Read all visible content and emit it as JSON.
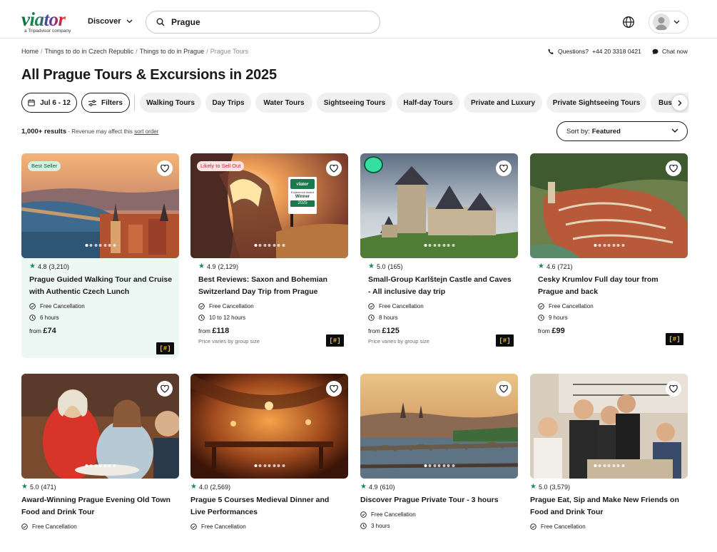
{
  "header": {
    "logo_text": "viator",
    "logo_sub": "a Tripadvisor company",
    "discover_label": "Discover",
    "search_value": "Prague"
  },
  "breadcrumb": [
    "Home",
    "Things to do in Czech Republic",
    "Things to do in Prague",
    "Prague Tours"
  ],
  "contact": {
    "questions_label": "Questions?",
    "phone": "+44 20 3318 0421",
    "chat_label": "Chat now"
  },
  "page_title": "All Prague Tours & Excursions in 2025",
  "filters": {
    "date_label": "Jul 6 - 12",
    "filters_label": "Filters",
    "categories": [
      "Walking Tours",
      "Day Trips",
      "Water Tours",
      "Sightseeing Tours",
      "Half-day Tours",
      "Private and Luxury",
      "Private Sightseeing Tours",
      "Bus"
    ]
  },
  "results": {
    "count": "1,000+ results",
    "note": "- Revenue may affect this",
    "sort_link": "sort order",
    "sort_prefix": "Sort by:",
    "sort_value": "Featured"
  },
  "products": [
    {
      "tag": "Best Seller",
      "rating": "4.8",
      "reviews": "(3,210)",
      "title": "Prague Guided Walking Tour and Cruise with Authentic Czech Lunch",
      "cancellation": "Free Cancellation",
      "duration": "6 hours",
      "price_prefix": "from",
      "price": "£74",
      "price_note": "",
      "badge": "[#]"
    },
    {
      "tag": "Likely to Sell Out",
      "rating": "4.9",
      "reviews": "(2,129)",
      "title": "Best Reviews: Saxon and Bohemian Switzerland Day Trip from Prague",
      "cancellation": "Free Cancellation",
      "duration": "10 to 12 hours",
      "price_prefix": "from",
      "price": "£118",
      "price_note": "Price varies by group size",
      "badge": "[#]",
      "award": {
        "brand": "viator",
        "line1": "Experience Award",
        "line2": "Winner",
        "year": "2025"
      }
    },
    {
      "tag": "",
      "rating": "5.0",
      "reviews": "(165)",
      "title": "Small-Group Karlštejn Castle and Caves - All inclusive day trip",
      "cancellation": "Free Cancellation",
      "duration": "8 hours",
      "price_prefix": "from",
      "price": "£125",
      "price_note": "Price varies by group size",
      "badge": "[#]"
    },
    {
      "tag": "",
      "rating": "4.6",
      "reviews": "(721)",
      "title": "Cesky Krumlov Full day tour from Prague and back",
      "cancellation": "Free Cancellation",
      "duration": "9 hours",
      "price_prefix": "from",
      "price": "£99",
      "price_note": "",
      "badge": "[#]"
    },
    {
      "tag": "",
      "rating": "5.0",
      "reviews": "(471)",
      "title": "Award-Winning Prague Evening Old Town Food and Drink Tour",
      "cancellation": "Free Cancellation",
      "duration": ""
    },
    {
      "tag": "",
      "rating": "4.0",
      "reviews": "(2,569)",
      "title": "Prague 5 Courses Medieval Dinner and Live Performances",
      "cancellation": "Free Cancellation",
      "duration": ""
    },
    {
      "tag": "",
      "rating": "4.9",
      "reviews": "(610)",
      "title": "Discover Prague Private Tour - 3 hours",
      "cancellation": "Free Cancellation",
      "duration": "3 hours"
    },
    {
      "tag": "",
      "rating": "5.0",
      "reviews": "(3,579)",
      "title": "Prague Eat, Sip and Make New Friends on Food and Drink Tour",
      "cancellation": "Free Cancellation",
      "duration": ""
    }
  ],
  "colors": {
    "brand_green": "#1b8a52",
    "highlight_bg": "#edf7f3",
    "badge_bg": "#0c0c0c",
    "badge_fg": "#f1c232"
  }
}
